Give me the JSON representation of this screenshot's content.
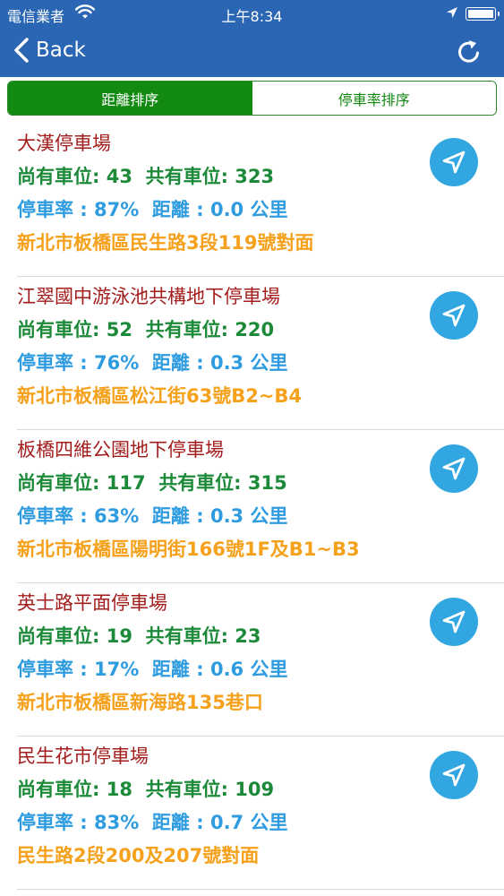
{
  "status_bar": {
    "carrier": "電信業者",
    "time": "上午8:34"
  },
  "nav_bar": {
    "back_label": "Back"
  },
  "tabs": [
    {
      "label": "距離排序",
      "selected": true
    },
    {
      "label": "停車率排序",
      "selected": false
    }
  ],
  "labels": {
    "available": "尚有車位: ",
    "total": "共有車位: ",
    "rate": "停車率 : ",
    "distance": "距離 : ",
    "distance_unit": "公里"
  },
  "lots": [
    {
      "name": "大漢停車場",
      "available": "43",
      "total": "323",
      "rate": "87%",
      "distance": "0.0",
      "address": "新北市板橋區民生路3段119號對面"
    },
    {
      "name": "江翠國中游泳池共構地下停車場",
      "available": "52",
      "total": "220",
      "rate": "76%",
      "distance": "0.3",
      "address": "新北市板橋區松江街63號B2~B4"
    },
    {
      "name": "板橋四維公園地下停車場",
      "available": "117",
      "total": "315",
      "rate": "63%",
      "distance": "0.3",
      "address": "新北市板橋區陽明街166號1F及B1~B3"
    },
    {
      "name": "英士路平面停車場",
      "available": "19",
      "total": "23",
      "rate": "17%",
      "distance": "0.6",
      "address": "新北市板橋區新海路135巷口"
    },
    {
      "name": "民生花市停車場",
      "available": "18",
      "total": "109",
      "rate": "83%",
      "distance": "0.7",
      "address": "民生路2段200及207號對面"
    }
  ],
  "colors": {
    "nav_bar": "#2a66b3",
    "segment_active": "#128a12",
    "name": "#a31c1c",
    "spaces": "#1d8a3a",
    "rate": "#2f9ce0",
    "address": "#f5a11c",
    "nav_button": "#31a6e0"
  }
}
